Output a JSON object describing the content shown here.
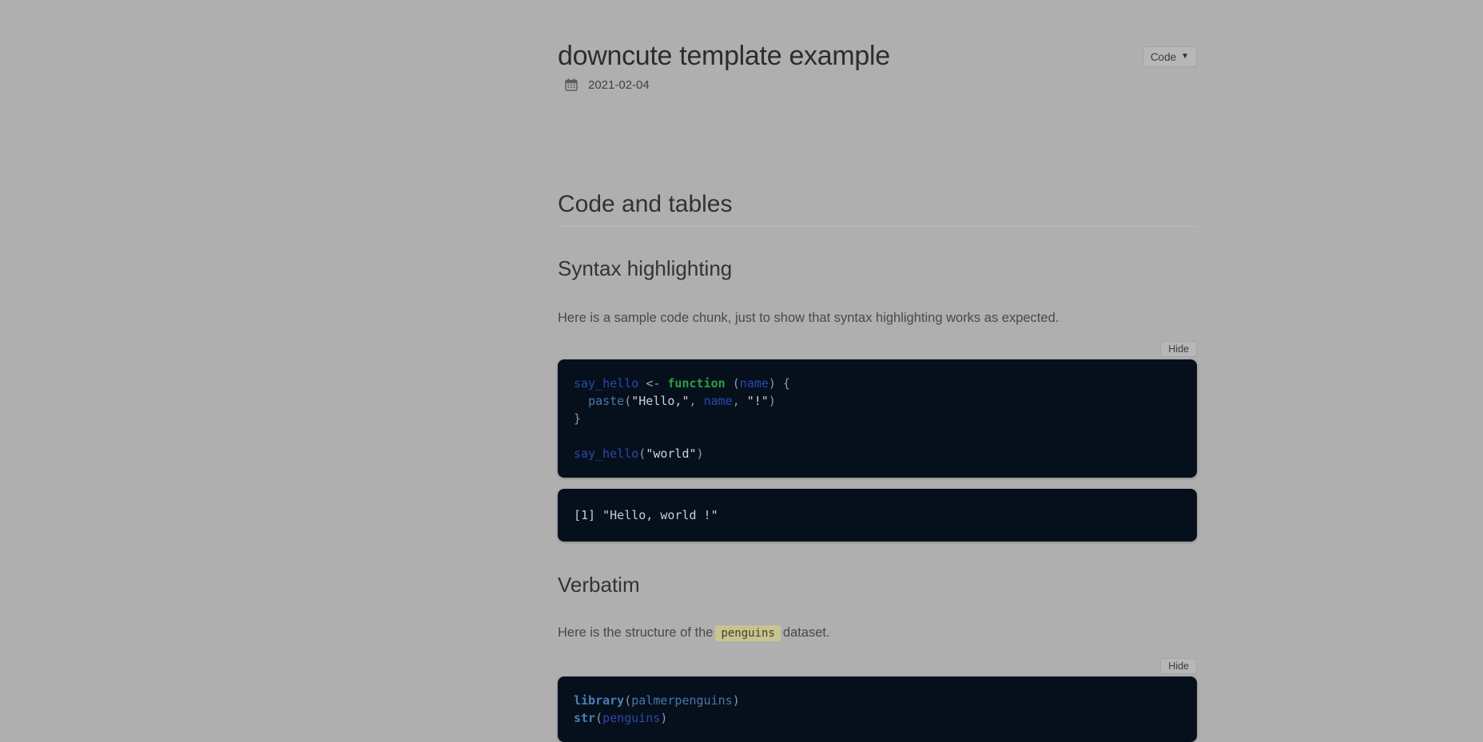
{
  "theme": {
    "page_background": "#afafaf",
    "code_block_background": "#06101d",
    "keyword_green": "#2f9e44",
    "variable_blue": "#2d46ae",
    "function_blue": "#4878a6",
    "string_color": "#ccd3da",
    "inline_code_background": "#c9c48f",
    "button_background": "#b7b7b7"
  },
  "header": {
    "title": "downcute template example",
    "date": "2021-02-04",
    "code_menu_label": "Code"
  },
  "labels": {
    "hide": "Hide"
  },
  "content": {
    "section_heading": "Code and tables",
    "syntax_highlighting": {
      "heading": "Syntax highlighting",
      "intro": "Here is a sample code chunk, just to show that syntax highlighting works as expected.",
      "output": "[1] \"Hello, world !\""
    },
    "verbatim": {
      "heading": "Verbatim",
      "intro_before": "Here is the structure of the",
      "inline_code": "penguins",
      "intro_after": "dataset."
    }
  },
  "code_blocks": {
    "say_hello": [
      [
        {
          "t": "say_hello",
          "c": "v"
        },
        {
          "t": " ",
          "c": "n"
        },
        {
          "t": "<-",
          "c": "o"
        },
        {
          "t": " ",
          "c": "n"
        },
        {
          "t": "function",
          "c": "k"
        },
        {
          "t": " ",
          "c": "n"
        },
        {
          "t": "(",
          "c": "p"
        },
        {
          "t": "name",
          "c": "v"
        },
        {
          "t": ")",
          "c": "p"
        },
        {
          "t": " ",
          "c": "n"
        },
        {
          "t": "{",
          "c": "p"
        }
      ],
      [
        {
          "t": "  ",
          "c": "n"
        },
        {
          "t": "paste",
          "c": "f"
        },
        {
          "t": "(",
          "c": "p"
        },
        {
          "t": "\"Hello,\"",
          "c": "s"
        },
        {
          "t": ",",
          "c": "p"
        },
        {
          "t": " ",
          "c": "n"
        },
        {
          "t": "name",
          "c": "v"
        },
        {
          "t": ",",
          "c": "p"
        },
        {
          "t": " ",
          "c": "n"
        },
        {
          "t": "\"!\"",
          "c": "s"
        },
        {
          "t": ")",
          "c": "p"
        }
      ],
      [
        {
          "t": "}",
          "c": "p"
        }
      ],
      [],
      [
        {
          "t": "say_hello",
          "c": "v"
        },
        {
          "t": "(",
          "c": "p"
        },
        {
          "t": "\"world\"",
          "c": "s"
        },
        {
          "t": ")",
          "c": "p"
        }
      ]
    ],
    "penguins_str": [
      [
        {
          "t": "library",
          "c": "fb"
        },
        {
          "t": "(",
          "c": "p"
        },
        {
          "t": "palmerpenguins",
          "c": "f"
        },
        {
          "t": ")",
          "c": "p"
        }
      ],
      [
        {
          "t": "str",
          "c": "fb"
        },
        {
          "t": "(",
          "c": "p"
        },
        {
          "t": "penguins",
          "c": "v"
        },
        {
          "t": ")",
          "c": "p"
        }
      ]
    ]
  }
}
